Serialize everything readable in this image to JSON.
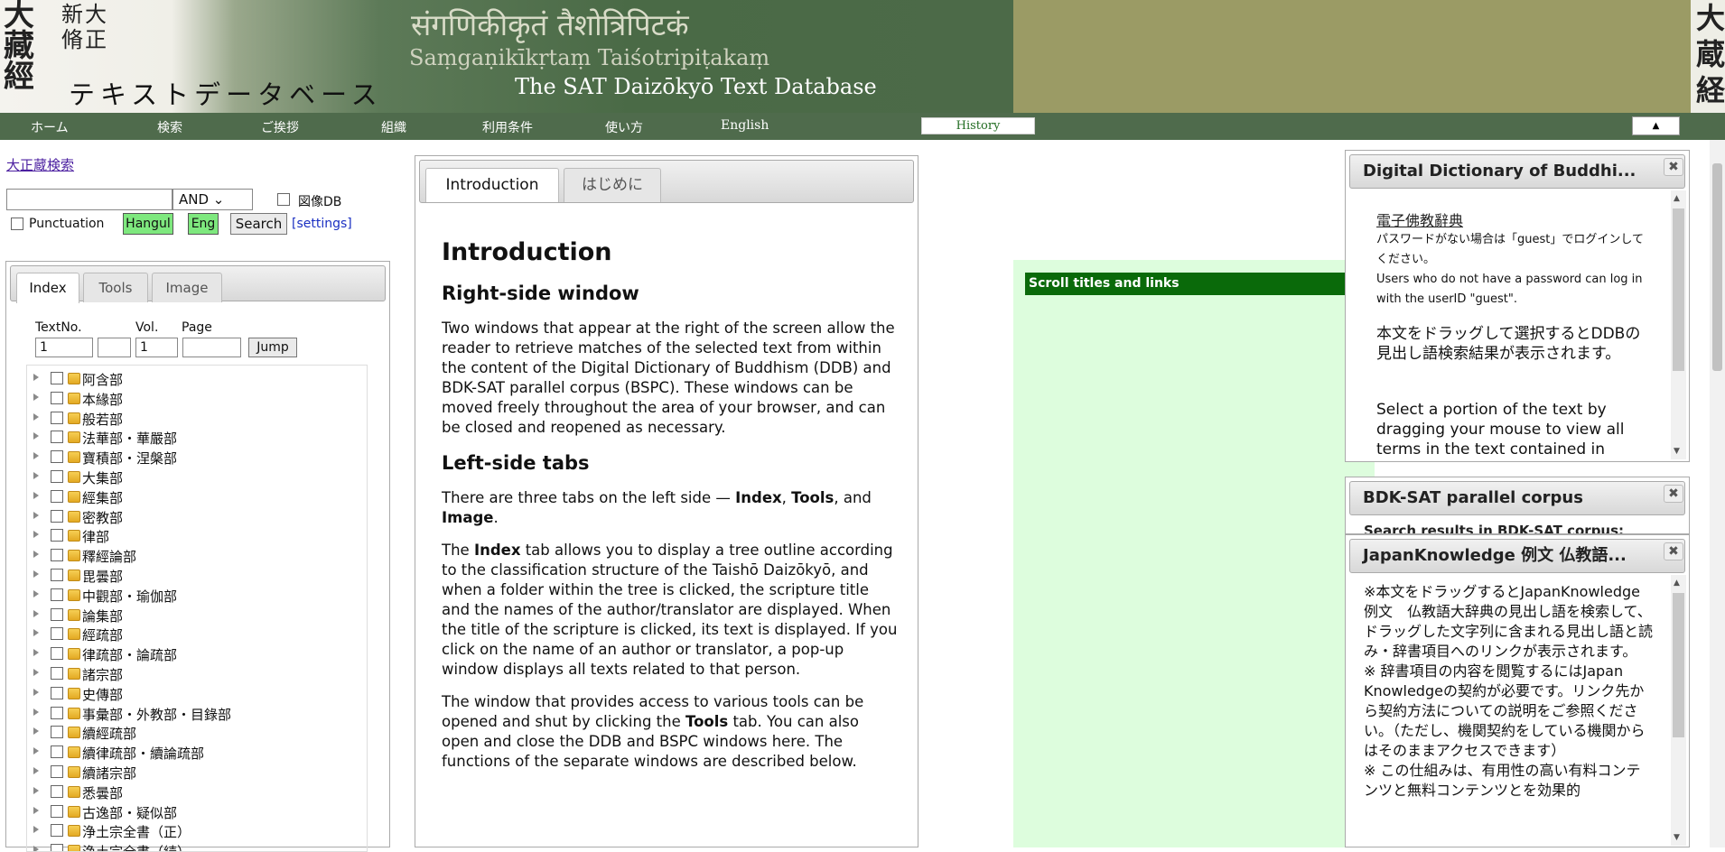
{
  "header": {
    "logo_kanji": "大藏經",
    "logo_small": "新大脩正",
    "logo_text": "テキストデータベース",
    "title_sanskrit": "संगणिकीकृतं तैशोत्रिपिटकं",
    "title_roman": "Saṃgaṇikīkṛtaṃ Taiśotripiṭakaṃ",
    "title_en": "The SAT Daizōkyō Text Database",
    "right_edge": "大蔵経"
  },
  "nav": {
    "items": [
      "ホーム",
      "検索",
      "ご挨拶",
      "組織",
      "利用条件",
      "使い方",
      "English"
    ],
    "history": "History",
    "collapse": "▲"
  },
  "search": {
    "link": "大正蔵検索",
    "operator": "AND ⌄",
    "image_db": "図像DB",
    "punctuation": "Punctuation",
    "hangul": "Hangul",
    "eng": "Eng",
    "search_btn": "Search",
    "settings": "[settings]"
  },
  "left_tabs": [
    "Index",
    "Tools",
    "Image"
  ],
  "jump": {
    "textno_label": "TextNo.",
    "vol_label": "Vol.",
    "page_label": "Page",
    "textno_value": "1",
    "vol_value": "1",
    "jump_btn": "Jump"
  },
  "tree": [
    "阿含部",
    "本緣部",
    "般若部",
    "法華部・華嚴部",
    "寶積部・涅槃部",
    "大集部",
    "經集部",
    "密教部",
    "律部",
    "釋經論部",
    "毘曇部",
    "中觀部・瑜伽部",
    "論集部",
    "經疏部",
    "律疏部・論疏部",
    "諸宗部",
    "史傳部",
    "事彙部・外教部・目錄部",
    "續經疏部",
    "續律疏部・續論疏部",
    "續諸宗部",
    "悉曇部",
    "古逸部・疑似部",
    "浄土宗全書（正）",
    "浄土宗全書（続）"
  ],
  "center": {
    "tabs": [
      "Introduction",
      "はじめに"
    ],
    "h1": "Introduction",
    "h2_1": "Right-side window",
    "p1": "Two windows that appear at the right of the screen allow the reader to retrieve matches of the selected text from within the content of the Digital Dictionary of Buddhism (DDB) and BDK-SAT parallel corpus (BSPC). These windows can be moved freely throughout the area of your browser, and can be closed and reopened as necessary.",
    "h2_2": "Left-side tabs",
    "p2_a": "There are three tabs on the left side — ",
    "p2_b1": "Index",
    "p2_c1": ", ",
    "p2_b2": "Tools",
    "p2_c2": ", and ",
    "p2_b3": "Image",
    "p2_d": ".",
    "p3_a": "The ",
    "p3_b": "Index",
    "p3_c": " tab allows you to display a tree outline according to the classification structure of the Taishō Daizōkyō, and when a folder within the tree is clicked, the scripture title and the names of the author/translator are displayed. When the title of the scripture is clicked, its text is displayed. If you click on the name of an author or translator, a pop-up window displays all texts related to that person.",
    "p4_a": "The window that provides access to various tools can be opened and shut by clicking the ",
    "p4_b": "Tools",
    "p4_c": " tab. You can also open and close the DDB and BSPC windows here. The functions of the separate windows are described below."
  },
  "scroll_titles": "Scroll titles and links",
  "ddb": {
    "title": "Digital Dictionary of Buddhi...",
    "link": "電子佛教辭典",
    "note_ja": "パスワードがない場合は「guest」でログインしてください。",
    "note_en": "Users who do not have a password can log in with the userID \"guest\".",
    "body_ja": "本文をドラッグして選択するとDDBの見出し語検索結果が表示されます。",
    "body_en": "Select a portion of the text by dragging your mouse to view all terms in the text contained in"
  },
  "bdk": {
    "title": "BDK-SAT parallel corpus",
    "body": "Search results in BDK-SAT corpus:"
  },
  "jk": {
    "title": "JapanKnowledge 例文 仏教語...",
    "body": "※本文をドラッグするとJapanKnowledge 例文　仏教語大辞典の見出し語を検索して、ドラッグした文字列に含まれる見出し語と読み・辞書項目へのリンクが表示されます。\n※ 辞書項目の内容を閲覧するにはJapan Knowledgeの契約が必要です。リンク先から契約方法についての説明をご参照ください。（ただし、機関契約をしている機関からはそのままアクセスできます）\n※ この仕組みは、有用性の高い有料コンテンツと無料コンテンツとを効果的"
  },
  "colors": {
    "nav_bg": "#4f6b4c",
    "olive": "#9b9b65",
    "green_bar": "#0a6a0a",
    "light_green": "#ddfddd",
    "button_green": "#7ee87e"
  },
  "icons": [
    "close-icon",
    "folder-icon",
    "expand-triangle-icon",
    "scroll-up-icon",
    "scroll-down-icon"
  ]
}
